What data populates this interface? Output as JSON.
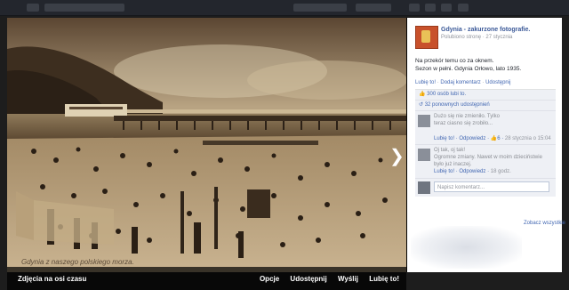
{
  "photo": {
    "caption": "Gdynia  z naszego polskiego morza."
  },
  "bottom_bar": {
    "album_label": "Zdjęcia na osi czasu",
    "actions": [
      "Opcje",
      "Udostępnij",
      "Wyślij",
      "Lubię to!"
    ]
  },
  "post": {
    "page_name": "Gdynia - zakurzone fotografie.",
    "meta": "Polubiono stronę · 27 stycznia",
    "lines": [
      "Na przekór temu co za oknem.",
      "Sezon w pełni. Gdynia Orłowo, lato 1935."
    ],
    "links": [
      "Lubię to!",
      "Dodaj komentarz",
      "Udostępnij"
    ],
    "likes": "300 osób lubi to.",
    "shares": "32 ponownych udostępnień"
  },
  "comments": [
    {
      "lines": [
        "Dużo się nie zmieniło. Tylko",
        "teraz ciasno się zrobiło..."
      ],
      "like": "Lubię to!",
      "reply": "Odpowiedz",
      "count": "6",
      "time": "28 stycznia o 15:04"
    },
    {
      "lines": [
        "Oj tak, oj tak!",
        "Ogromne zmiany. Nawet w moim dzieciństwie",
        "było już inaczej."
      ],
      "like": "Lubię to!",
      "reply": "Odpowiedz",
      "time": "18 godz."
    }
  ],
  "comment_placeholder": "Napisz komentarz...",
  "all_sizes": "Zobacz wszystkie"
}
